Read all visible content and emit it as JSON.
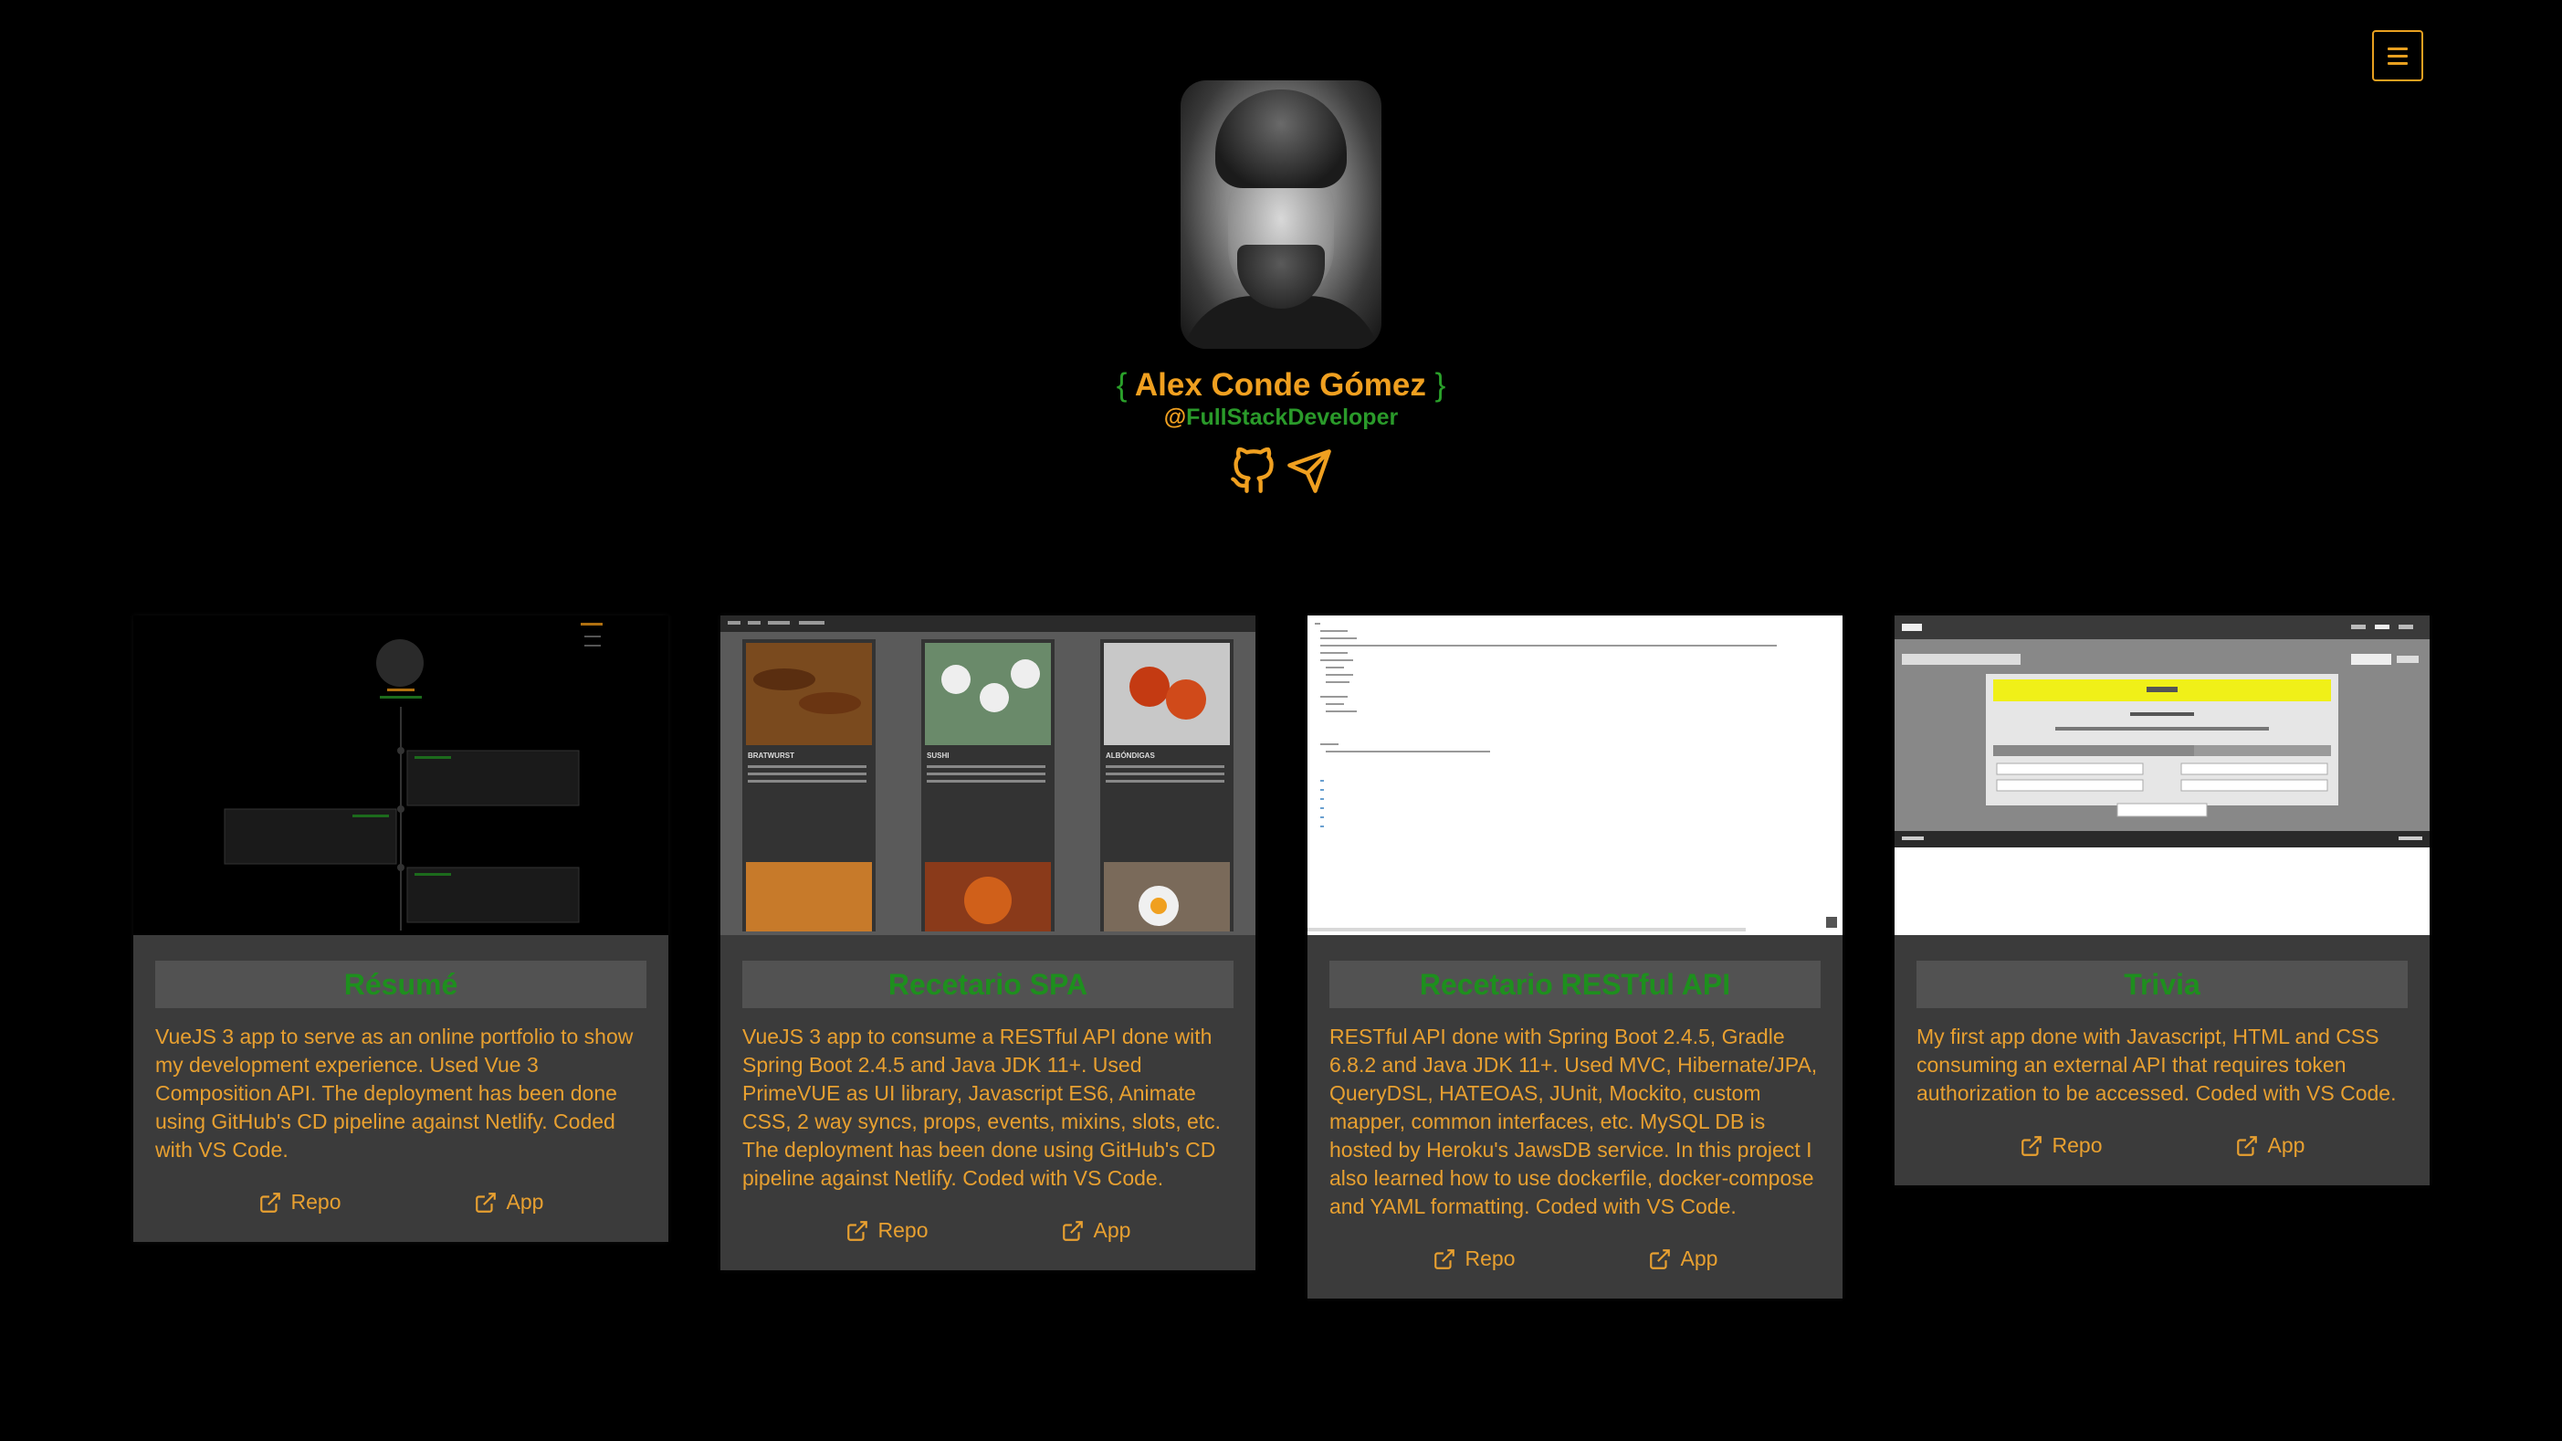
{
  "header": {
    "name_open_brace": "{",
    "name": "Alex Conde Gómez",
    "name_close_brace": "}",
    "handle_at": "@",
    "handle": "FullStackDeveloper",
    "icons": [
      "menu-icon",
      "github-icon",
      "send-icon"
    ]
  },
  "colors": {
    "background": "#000000",
    "accent_orange": "#f0a020",
    "accent_green": "#2aa12a",
    "card_bg": "#3b3b3b",
    "card_title_bg": "#525252"
  },
  "projects": [
    {
      "title": "Résumé",
      "description": "VueJS 3 app to serve as an online portfolio to show my development experience. Used Vue 3 Composition API. The deployment has been done using GitHub's CD pipeline against Netlify. Coded with VS Code.",
      "repo_label": "Repo",
      "app_label": "App"
    },
    {
      "title": "Recetario SPA",
      "description": "VueJS 3 app to consume a RESTful API done with Spring Boot 2.4.5 and Java JDK 11+. Used PrimeVUE as UI library, Javascript ES6, Animate CSS, 2 way syncs, props, events, mixins, slots, etc. The deployment has been done using GitHub's CD pipeline against Netlify. Coded with VS Code.",
      "repo_label": "Repo",
      "app_label": "App",
      "thumb_labels": [
        "BRATWURST",
        "SUSHI",
        "ALBÓNDIGAS"
      ]
    },
    {
      "title": "Recetario RESTful API",
      "description": "RESTful API done with Spring Boot 2.4.5, Gradle 6.8.2 and Java JDK 11+. Used MVC, Hibernate/JPA, QueryDSL, HATEOAS, JUnit, Mockito, custom mapper, common interfaces, etc. MySQL DB is hosted by Heroku's JawsDB service. In this project I also learned how to use dockerfile, docker-compose and YAML formatting. Coded with VS Code.",
      "repo_label": "Repo",
      "app_label": "App"
    },
    {
      "title": "Trivia",
      "description": "My first app done with Javascript, HTML and CSS consuming an external API that requires token authorization to be accessed. Coded with VS Code.",
      "repo_label": "Repo",
      "app_label": "App"
    }
  ]
}
